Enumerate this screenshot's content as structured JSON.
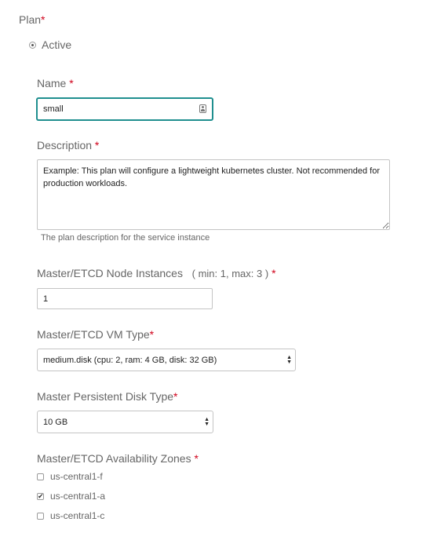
{
  "plan": {
    "label": "Plan",
    "required_mark": "*",
    "option_label": "Active"
  },
  "name_field": {
    "label": "Name",
    "required_mark": "*",
    "value": "small"
  },
  "description_field": {
    "label": "Description",
    "required_mark": "*",
    "value": "Example: This plan will configure a lightweight kubernetes cluster. Not recommended for production workloads.",
    "help_text": "The plan description for the service instance"
  },
  "node_instances": {
    "label": "Master/ETCD Node Instances",
    "range": "( min: 1, max: 3 )",
    "required_mark": "*",
    "value": "1"
  },
  "vm_type": {
    "label": "Master/ETCD VM Type",
    "required_mark": "*",
    "selected": "medium.disk (cpu: 2, ram: 4 GB, disk: 32 GB)"
  },
  "disk_type": {
    "label": "Master Persistent Disk Type",
    "required_mark": "*",
    "selected": "10 GB"
  },
  "availability_zones": {
    "label": "Master/ETCD Availability Zones",
    "required_mark": "*",
    "zones": [
      {
        "label": "us-central1-f",
        "checked": false,
        "mark": ""
      },
      {
        "label": "us-central1-a",
        "checked": true,
        "mark": "✔"
      },
      {
        "label": "us-central1-c",
        "checked": false,
        "mark": ""
      }
    ]
  }
}
